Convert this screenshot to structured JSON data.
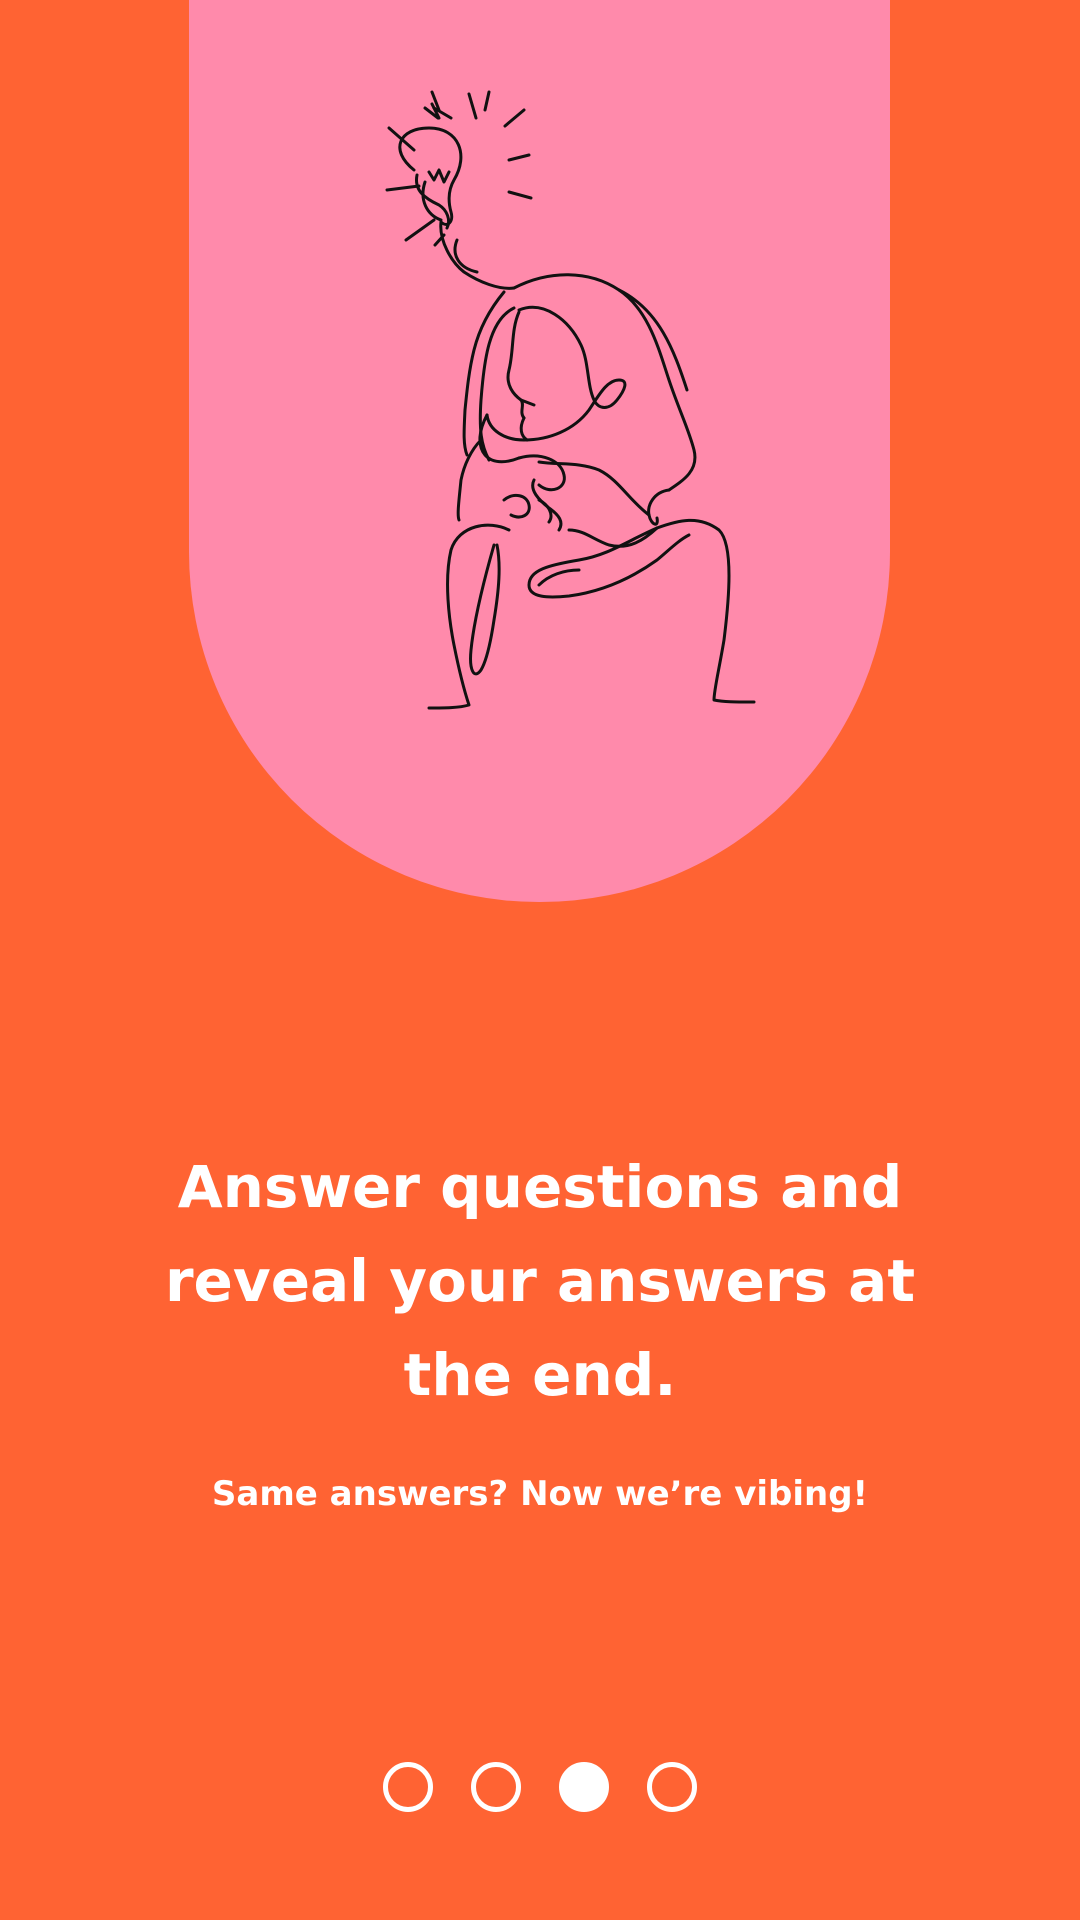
{
  "onboarding": {
    "headline": "Answer questions and reveal your answers at the end.",
    "subtitle": "Same answers? Now we’re vibing!",
    "illustration_icon": "thinking-person-lightbulb-line-art",
    "colors": {
      "background": "#FF6333",
      "hero": "#FF8AAB",
      "text": "#FFFFFF",
      "line_art": "#111111"
    }
  },
  "pagination": {
    "total": 4,
    "active_index": 2
  }
}
